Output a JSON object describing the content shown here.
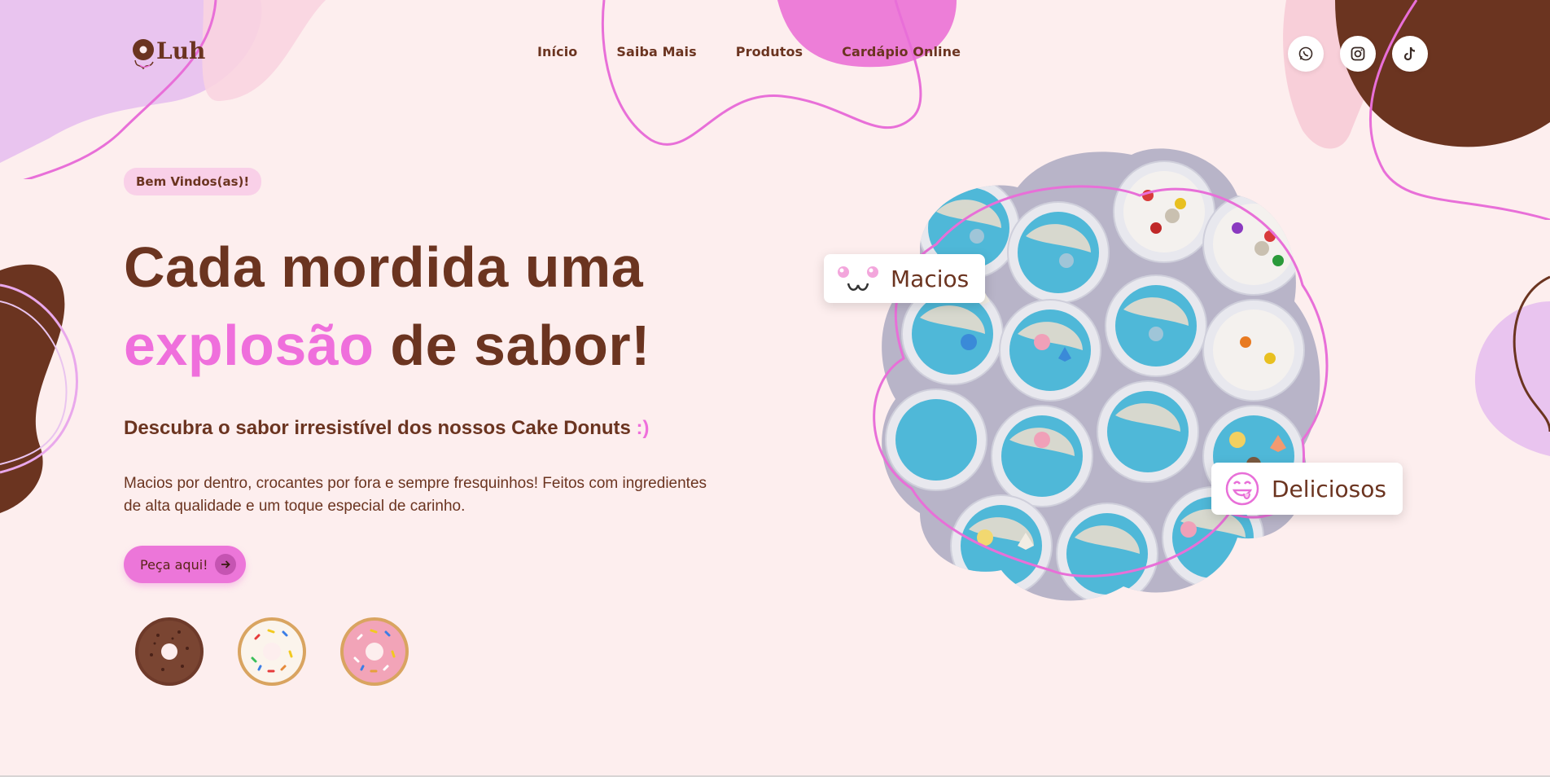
{
  "brand": {
    "logo_text": "Luh"
  },
  "nav": {
    "items": [
      "Início",
      "Saiba Mais",
      "Produtos",
      "Cardápio Online"
    ]
  },
  "socials": [
    {
      "icon": "whatsapp-icon"
    },
    {
      "icon": "instagram-icon"
    },
    {
      "icon": "tiktok-icon"
    }
  ],
  "hero": {
    "badge": "Bem Vindos(as)!",
    "headline_line1": "Cada mordida uma",
    "headline_highlight": "explosão",
    "headline_rest": " de sabor!",
    "subtitle": "Descubra o sabor irresistível dos nossos Cake Donuts ",
    "subtitle_smile": ":)",
    "description": "Macios por dentro, crocantes por fora e sempre fresquinhos! Feitos com ingredientes de alta qualidade e um toque especial de carinho.",
    "cta_label": "Peça aqui!"
  },
  "thumbnails": [
    "chocolate-donut",
    "vanilla-sprinkles-donut",
    "pink-sprinkles-donut"
  ],
  "tags": {
    "soft": "Macios",
    "delicious": "Deliciosos"
  },
  "colors": {
    "background": "#fdeeee",
    "brown": "#6b3420",
    "pink": "#ef6fdc",
    "lilac": "#e9c4ef",
    "light_pink": "#f9d0e8"
  }
}
